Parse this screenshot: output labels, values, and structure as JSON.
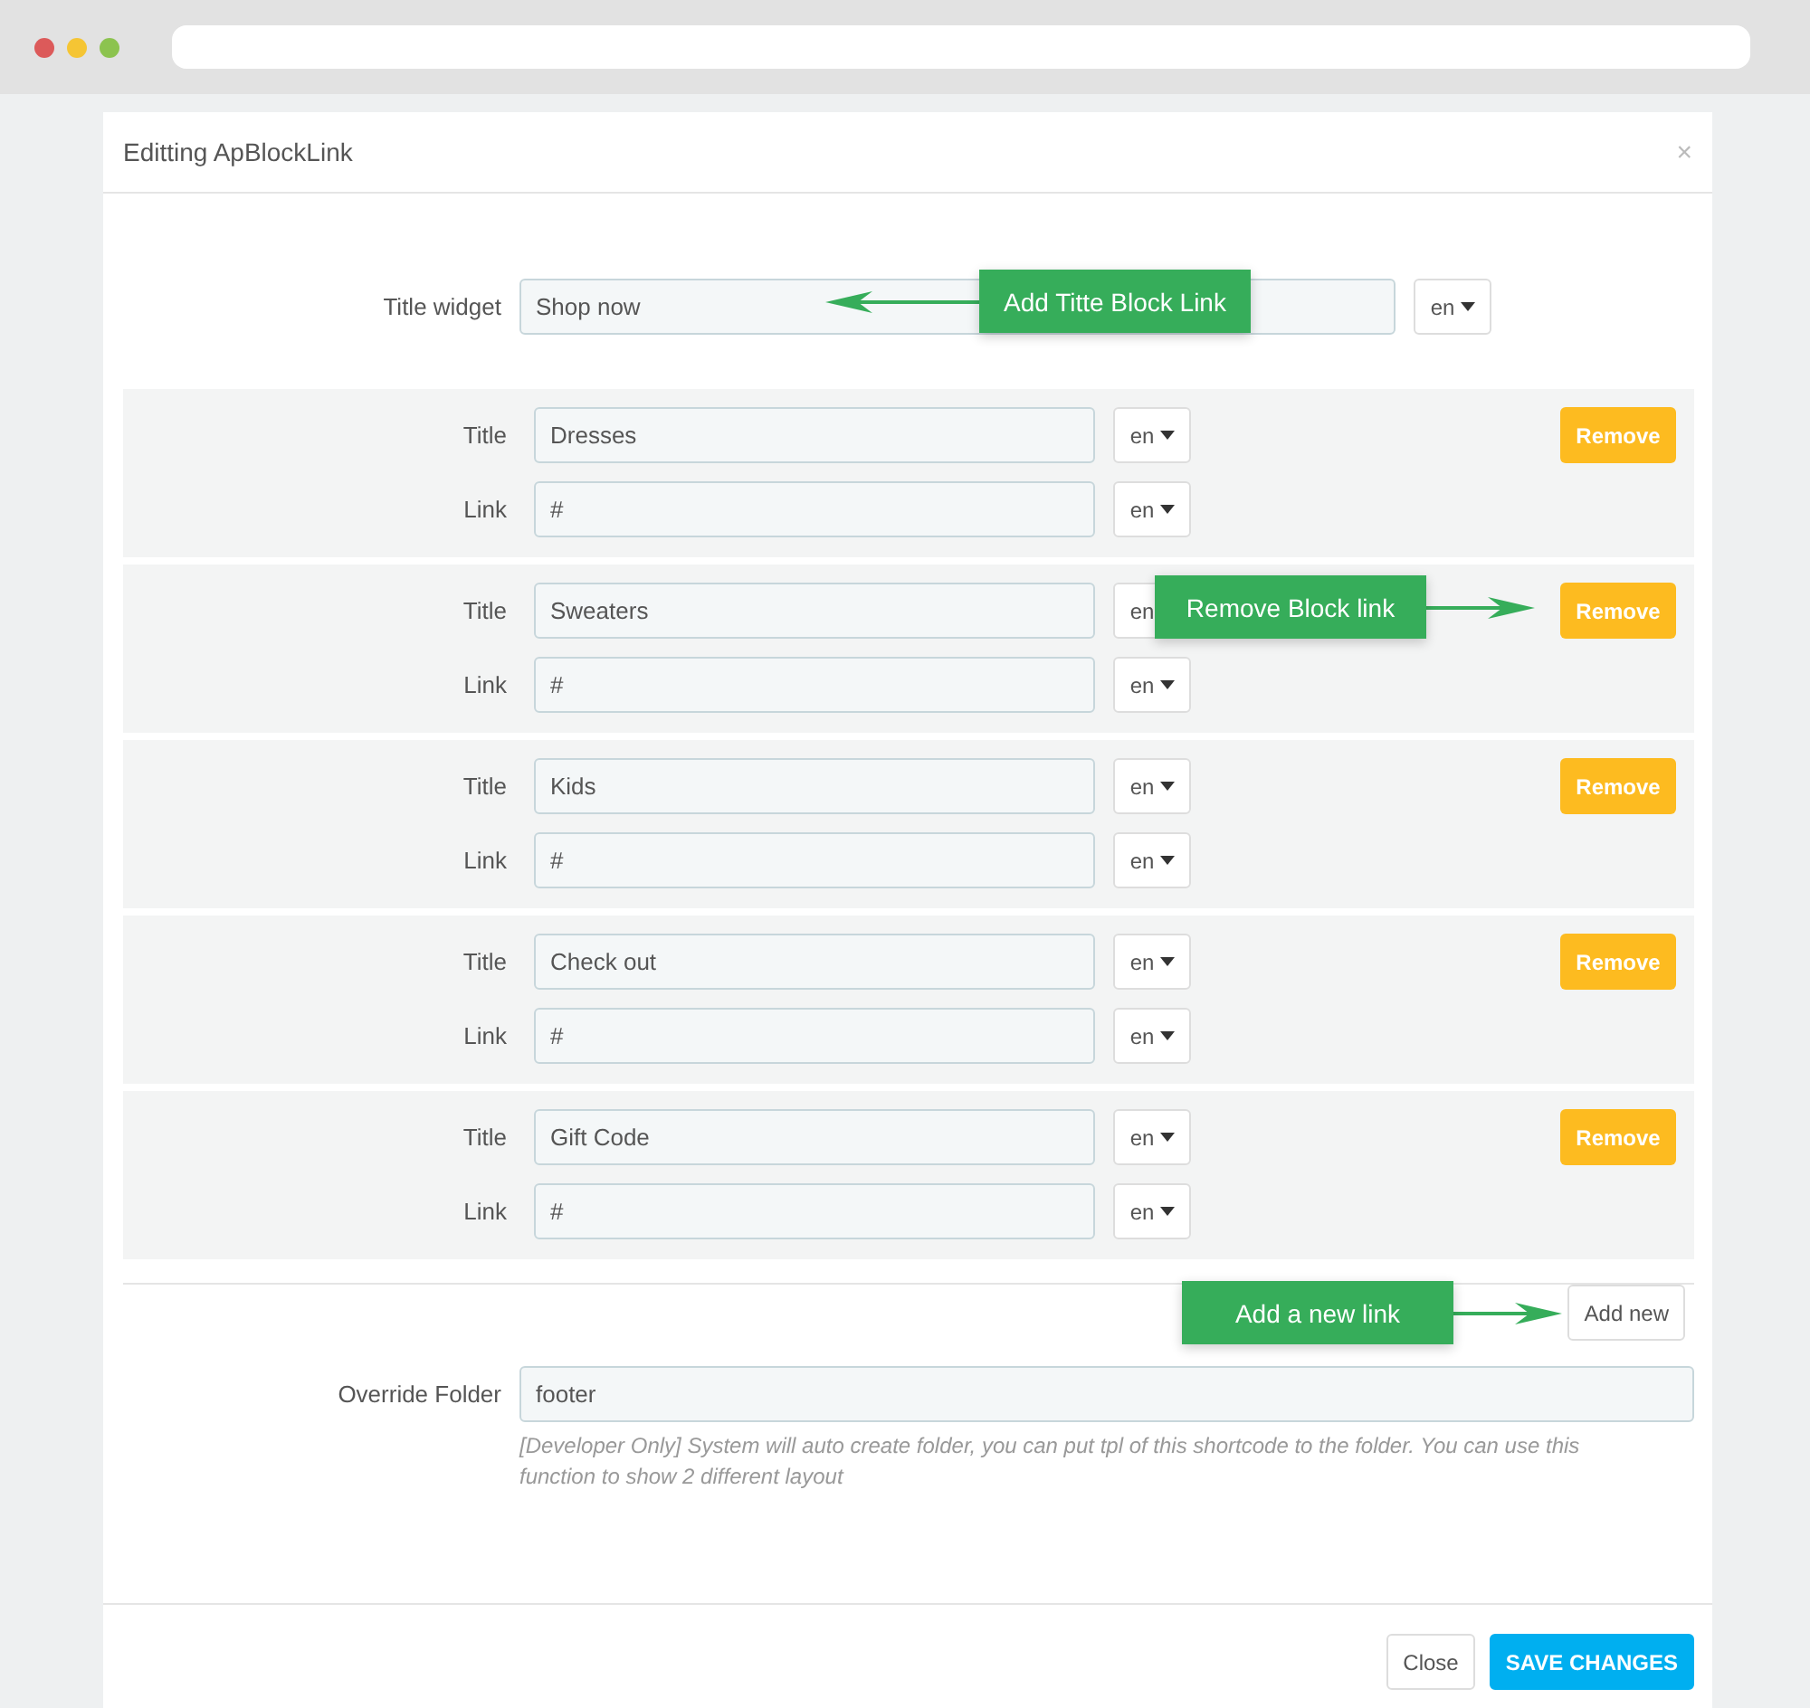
{
  "dialog": {
    "title": "Editting ApBlockLink",
    "close": "×",
    "title_widget": {
      "label": "Title widget",
      "value": "Shop now",
      "language": "en"
    },
    "links": [
      {
        "title_label": "Title",
        "title": "Dresses",
        "title_language": "en",
        "link_label": "Link",
        "link": "#",
        "link_language": "en",
        "remove": "Remove"
      },
      {
        "title_label": "Title",
        "title": "Sweaters",
        "title_language": "en",
        "link_label": "Link",
        "link": "#",
        "link_language": "en",
        "remove": "Remove"
      },
      {
        "title_label": "Title",
        "title": "Kids",
        "title_language": "en",
        "link_label": "Link",
        "link": "#",
        "link_language": "en",
        "remove": "Remove"
      },
      {
        "title_label": "Title",
        "title": "Check out",
        "title_language": "en",
        "link_label": "Link",
        "link": "#",
        "link_language": "en",
        "remove": "Remove"
      },
      {
        "title_label": "Title",
        "title": "Gift Code",
        "title_language": "en",
        "link_label": "Link",
        "link": "#",
        "link_language": "en",
        "remove": "Remove"
      }
    ],
    "add_new": "Add new",
    "override_folder": {
      "label": "Override Folder",
      "value": "footer",
      "help": "[Developer Only] System will auto create folder, you can put tpl of this shortcode to the folder. You can use this function to show 2 different layout"
    },
    "buttons": [
      {
        "label": "Close",
        "kind": "default"
      },
      {
        "label": "SAVE CHANGES",
        "kind": "primary"
      }
    ]
  },
  "annotations": [
    {
      "text": "Add Titte Block Link",
      "kind": "left"
    },
    {
      "text": "Remove Block link",
      "kind": "right"
    },
    {
      "text": "Add a new link",
      "kind": "right"
    }
  ]
}
